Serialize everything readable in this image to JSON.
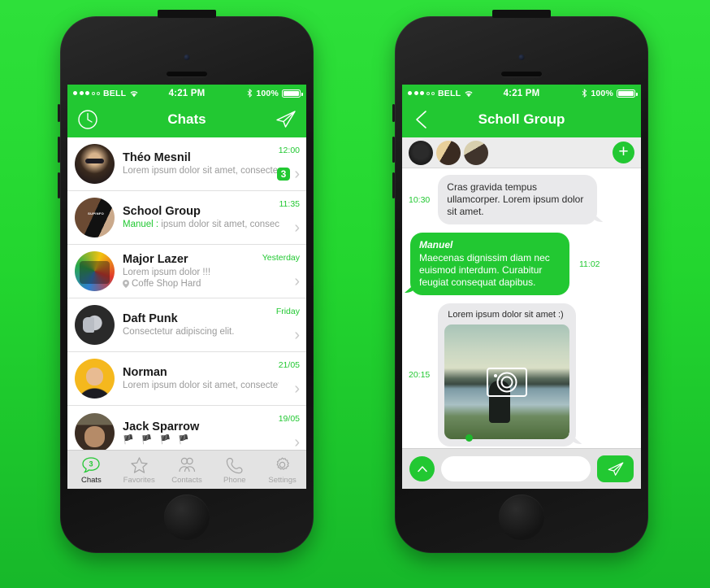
{
  "theme": {
    "brand_green": "#22c832",
    "background_green_top": "#2ee03a",
    "background_green_bottom": "#17b82a",
    "bubble_gray": "#e9e9eb",
    "tabbar_gray": "#e3e3e3"
  },
  "status_bar": {
    "carrier": "BELL",
    "signal_filled": 3,
    "signal_empty": 2,
    "wifi_icon": "wifi-icon",
    "time": "4:21 PM",
    "bluetooth_icon": "bluetooth-icon",
    "battery_percent": "100%",
    "battery_icon": "battery-full-icon"
  },
  "chats_screen": {
    "navbar": {
      "left_icon": "clock-icon",
      "title": "Chats",
      "right_icon": "compose-paper-plane-icon"
    },
    "rows": [
      {
        "name": "Théo Mesnil",
        "preview_sender": "",
        "preview": "Lorem ipsum dolor sit amet, consectetur adipiscing elit.",
        "time": "12:00",
        "badge": "3",
        "avatar": "av-theo",
        "location": "",
        "flags": ""
      },
      {
        "name": "School Group",
        "preview_sender": "Manuel :",
        "preview": " ipsum dolor sit amet, consectetur adipiscing elit.",
        "time": "11:35",
        "badge": "",
        "avatar": "av-school",
        "location": "",
        "flags": ""
      },
      {
        "name": "Major Lazer",
        "preview_sender": "",
        "preview": "Lorem ipsum dolor !!!",
        "time": "Yesterday",
        "badge": "",
        "avatar": "av-lazer",
        "location": "Coffe Shop Hard",
        "flags": ""
      },
      {
        "name": "Daft Punk",
        "preview_sender": "",
        "preview": "Consectetur adipiscing elit.",
        "time": "Friday",
        "badge": "",
        "avatar": "av-daft",
        "location": "",
        "flags": ""
      },
      {
        "name": "Norman",
        "preview_sender": "",
        "preview": "Lorem ipsum dolor sit amet, consectetur...",
        "time": "21/05",
        "badge": "",
        "avatar": "av-norman",
        "location": "",
        "flags": ""
      },
      {
        "name": "Jack Sparrow",
        "preview_sender": "",
        "preview": "",
        "time": "19/05",
        "badge": "",
        "avatar": "av-jack",
        "location": "",
        "flags": "🏴 🏴 🏴 🏴"
      }
    ],
    "tabbar": [
      {
        "label": "Chats",
        "icon": "chat-bubble-icon",
        "badge": "3",
        "active": true
      },
      {
        "label": "Favorites",
        "icon": "star-icon",
        "badge": "",
        "active": false
      },
      {
        "label": "Contacts",
        "icon": "contacts-icon",
        "badge": "",
        "active": false
      },
      {
        "label": "Phone",
        "icon": "phone-handset-icon",
        "badge": "",
        "active": false
      },
      {
        "label": "Settings",
        "icon": "gear-icon",
        "badge": "",
        "active": false
      }
    ]
  },
  "conversation_screen": {
    "navbar": {
      "back_icon": "chevron-left-icon",
      "title": "Scholl Group"
    },
    "members": [
      {
        "avatar": "av-m1"
      },
      {
        "avatar": "av-m2"
      },
      {
        "avatar": "av-m3"
      }
    ],
    "add_member_label": "+",
    "messages": [
      {
        "kind": "text",
        "direction": "incoming",
        "time": "10:30",
        "sender": "",
        "text": "Cras gravida tempus ullamcorper. Lorem ipsum dolor sit amet."
      },
      {
        "kind": "text",
        "direction": "outgoing",
        "time": "11:02",
        "sender": "Manuel",
        "text": "Maecenas dignissim diam nec euismod interdum. Curabitur feugiat consequat dapibus."
      },
      {
        "kind": "photo",
        "direction": "incoming",
        "time": "20:15",
        "sender": "",
        "caption": "Lorem ipsum dolor sit amet :)",
        "overlay_icon": "camera-icon"
      }
    ],
    "input_bar": {
      "attach_icon": "chevron-up-icon",
      "input_value": "",
      "input_placeholder": "",
      "send_icon": "send-paper-plane-icon"
    }
  }
}
